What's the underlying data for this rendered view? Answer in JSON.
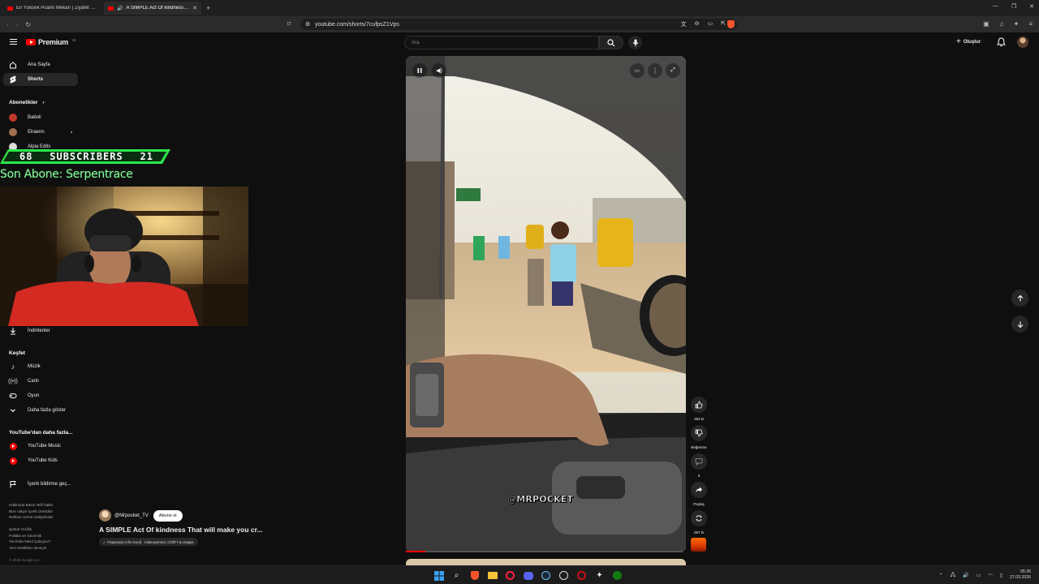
{
  "browser": {
    "tabs": [
      {
        "title": "En Yüksek Puanlı Mekan | Ziyafet Ku...",
        "active": false
      },
      {
        "title": "A SIMPLE Act Of kindness Th...",
        "active": true
      }
    ],
    "url": "youtube.com/shorts/7cufpsZ1Vps"
  },
  "masthead": {
    "logo": "Premium",
    "logo_region": "TR",
    "search_placeholder": "Ara",
    "create_label": "Oluştur"
  },
  "sidebar": {
    "home": "Ana Sayfa",
    "shorts": "Shorts",
    "subscriptions_header": "Abonelikler",
    "subscriptions": [
      {
        "name": "Baboli",
        "color": "#c0392b"
      },
      {
        "name": "Elraenn",
        "color": "#a07050"
      },
      {
        "name": "Alpia Edits",
        "color": "#dddddd"
      }
    ],
    "downloads": "İndirilenler",
    "explore_header": "Keşfet",
    "explore": [
      "Müzik",
      "Canlı",
      "Oyun",
      "Daha fazla göster"
    ],
    "more_header": "YouTube'dan daha fazla...",
    "more": [
      "YouTube Music",
      "YouTube Kids"
    ],
    "report": "İçerik bildirme geç...",
    "footer_lines": [
      "Hakkında  Basın  Telif hakkı",
      "Bize ulaşın  İçerik Üreticiler",
      "Reklam verme  Geliştiriciler"
    ],
    "footer_lines2": [
      "Şartlar  Gizlilik",
      "Politika ve Güvenlik",
      "YouTube Nasıl Çalışıyor?",
      "Yeni özellikleri deneyin"
    ],
    "copyright": "© 2026 Google LLC"
  },
  "stream_overlay": {
    "sub_count_left": "68",
    "sub_label": "SUBSCRIBERS",
    "sub_count_right": "21",
    "last_subscriber": "Son Abone: Serpentrace"
  },
  "short": {
    "watermark": "@MRPOCKET",
    "channel": "@Mrpocket_TV",
    "subscribe": "Abone ol",
    "title": "A SIMPLE Act Of kindness That will make you cr...",
    "music": "Papaoutai (Afro Soul) · mikeeysmind, Chill77 & Unjaps",
    "progress": 0.07,
    "actions": {
      "likes": "353 B",
      "dislike": "Beğenme",
      "comments": "0",
      "share": "Paylaş",
      "remix": "597 B"
    }
  },
  "taskbar": {
    "time": "05:36",
    "date": "27.03.2026"
  },
  "colors": {
    "accent": "#ff0000",
    "banner_green": "#2ee64a",
    "overlay_text_green": "#8dffa0"
  }
}
